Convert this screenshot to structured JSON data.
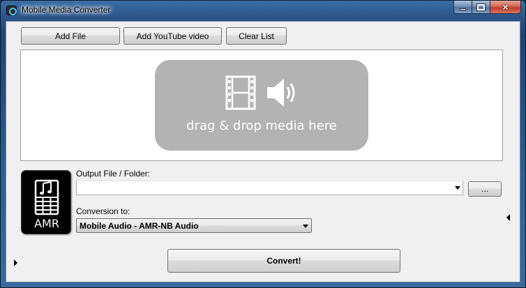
{
  "window": {
    "title": "Mobile Media Converter",
    "caption": {
      "minimize": "minimize",
      "maximize": "maximize",
      "close": "×"
    }
  },
  "toolbar": {
    "add_file": "Add File",
    "add_youtube": "Add YouTube video",
    "clear_list": "Clear List"
  },
  "drop_zone": {
    "text": "drag & drop media here",
    "icons": [
      "film-icon",
      "speaker-icon"
    ],
    "background": "#b3b3b3"
  },
  "format_tile": {
    "label": "AMR",
    "icon": "music-phone-icon"
  },
  "output": {
    "label": "Output File / Folder:",
    "value": "",
    "browse": "..."
  },
  "conversion": {
    "label": "Conversion to:",
    "selected": "Mobile Audio - AMR-NB Audio"
  },
  "actions": {
    "convert": "Convert!"
  }
}
